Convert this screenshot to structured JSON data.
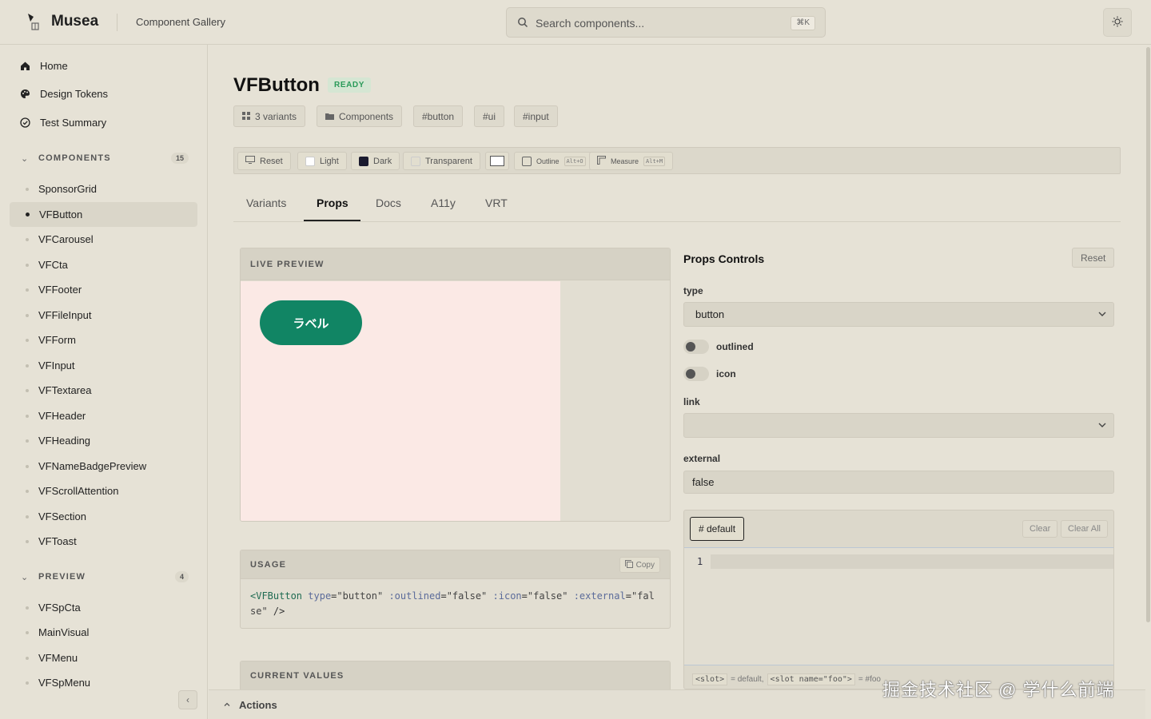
{
  "header": {
    "brand": "Musea",
    "subtitle": "Component Gallery",
    "search_placeholder": "Search components...",
    "search_shortcut": "⌘K"
  },
  "sidebar": {
    "nav": [
      {
        "label": "Home",
        "icon": "home-icon"
      },
      {
        "label": "Design Tokens",
        "icon": "palette-icon"
      },
      {
        "label": "Test Summary",
        "icon": "check-circle-icon"
      }
    ],
    "components_section": {
      "label": "COMPONENTS",
      "count": "15"
    },
    "components": [
      "SponsorGrid",
      "VFButton",
      "VFCarousel",
      "VFCta",
      "VFFooter",
      "VFFileInput",
      "VFForm",
      "VFInput",
      "VFTextarea",
      "VFHeader",
      "VFHeading",
      "VFNameBadgePreview",
      "VFScrollAttention",
      "VFSection",
      "VFToast"
    ],
    "active_component": "VFButton",
    "preview_section": {
      "label": "PREVIEW",
      "count": "4"
    },
    "preview_items": [
      "VFSpCta",
      "MainVisual",
      "VFMenu",
      "VFSpMenu"
    ]
  },
  "main": {
    "title": "VFButton",
    "status_badge": "READY",
    "tags": [
      "3 variants",
      "Components",
      "#button",
      "#ui",
      "#input"
    ],
    "toolbar": {
      "reset": "Reset",
      "light": "Light",
      "dark": "Dark",
      "transparent": "Transparent",
      "outline": "Outline",
      "outline_key": "Alt+O",
      "measure": "Measure",
      "measure_key": "Alt+M"
    },
    "tabs": [
      "Variants",
      "Props",
      "Docs",
      "A11y",
      "VRT"
    ],
    "active_tab": "Props",
    "live_preview": {
      "header": "LIVE PREVIEW",
      "button_label": "ラベル"
    },
    "usage": {
      "header": "USAGE",
      "copy": "Copy",
      "tag_open": "<VFButton",
      "attr_type": "type",
      "val_type": "\"button\"",
      "attr_outlined": ":outlined",
      "val_outlined": "\"false\"",
      "attr_icon": ":icon",
      "val_icon": "\"false\"",
      "attr_external": ":external",
      "val_external": "\"false\"",
      "tag_close": "/>"
    },
    "current_values": {
      "header": "CURRENT VALUES"
    },
    "props_controls": {
      "title": "Props Controls",
      "reset": "Reset",
      "type_label": "type",
      "type_value": "button",
      "outlined_label": "outlined",
      "icon_label": "icon",
      "link_label": "link",
      "link_value": "",
      "external_label": "external",
      "external_value": "false",
      "slot_tab": "# default",
      "clear": "Clear",
      "clear_all": "Clear All",
      "line_number": "1",
      "hint_slot": "<slot>",
      "hint_default": "= default,",
      "hint_named": "<slot name=\"foo\">",
      "hint_named_eq": "= #foo"
    },
    "actions_label": "Actions"
  },
  "colors": {
    "background": "#e6e2d6",
    "accent_green": "#118564",
    "ready_badge": "#2a9a59",
    "preview_bg": "#fbe9e5"
  },
  "watermark": "掘金技术社区 @ 学什么前端"
}
